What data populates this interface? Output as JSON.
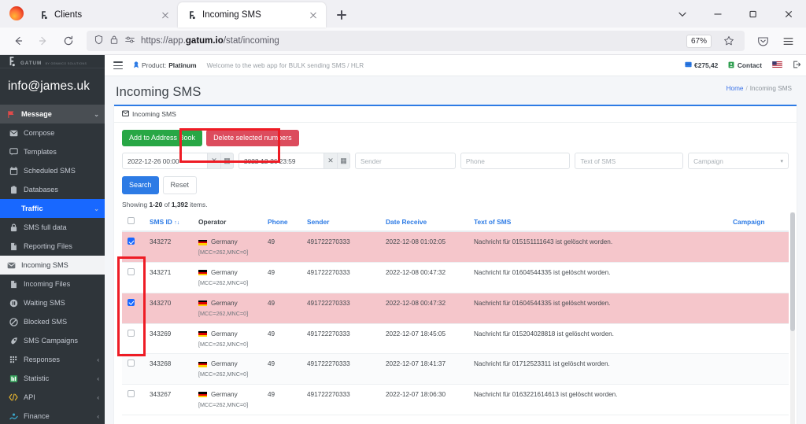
{
  "browser": {
    "tabs": [
      {
        "title": "Clients",
        "favicon": "gatum-favicon",
        "active": false
      },
      {
        "title": "Incoming SMS",
        "favicon": "gatum-favicon",
        "active": true
      }
    ],
    "new_tab_label": "+",
    "url_prefix": "https://app.",
    "url_domain": "gatum.io",
    "url_path": "/stat/incoming",
    "zoom_level": "67%",
    "window_controls": {
      "minimize": "–",
      "maximize": "▢",
      "close": "✕",
      "list_all_tabs": "⌄"
    }
  },
  "sidebar": {
    "brand_name": "GATUM",
    "brand_sub": "BY GENMICO SOLUTIONS",
    "user_email": "info@james.uk",
    "items": [
      {
        "label": "Message",
        "icon": "flag-icon",
        "state": "group-open",
        "caret": "⌄"
      },
      {
        "label": "Compose",
        "icon": "envelope-icon",
        "state": "child",
        "caret": ""
      },
      {
        "label": "Templates",
        "icon": "template-icon",
        "state": "child",
        "caret": ""
      },
      {
        "label": "Scheduled SMS",
        "icon": "calendar-icon",
        "state": "child",
        "caret": ""
      },
      {
        "label": "Databases",
        "icon": "database-icon",
        "state": "child",
        "caret": ""
      },
      {
        "label": "Traffic",
        "icon": "",
        "state": "active-blue",
        "caret": "⌄"
      },
      {
        "label": "SMS full data",
        "icon": "lock-icon",
        "state": "child",
        "caret": ""
      },
      {
        "label": "Reporting Files",
        "icon": "file-icon",
        "state": "child",
        "caret": ""
      },
      {
        "label": "Incoming SMS",
        "icon": "inbox-icon",
        "state": "active-white",
        "caret": ""
      },
      {
        "label": "Incoming Files",
        "icon": "file-icon",
        "state": "child",
        "caret": ""
      },
      {
        "label": "Waiting SMS",
        "icon": "pause-icon",
        "state": "child",
        "caret": ""
      },
      {
        "label": "Blocked SMS",
        "icon": "block-icon",
        "state": "child",
        "caret": ""
      },
      {
        "label": "SMS Campaigns",
        "icon": "rocket-icon",
        "state": "child",
        "caret": ""
      },
      {
        "label": "Responses",
        "icon": "keypad-icon",
        "state": "child",
        "caret": "‹"
      },
      {
        "label": "Statistic",
        "icon": "chart-icon",
        "state": "child",
        "caret": "‹"
      },
      {
        "label": "API",
        "icon": "code-icon",
        "state": "child",
        "caret": "‹"
      },
      {
        "label": "Finance",
        "icon": "finance-icon",
        "state": "child",
        "caret": "‹"
      }
    ]
  },
  "topbar": {
    "menu_toggle": "hamburger-icon",
    "product_label": "Product:",
    "product_value": "Platinum",
    "welcome": "Welcome to the web app for BULK sending SMS / HLR",
    "balance": "€275,42",
    "contact": "Contact",
    "language": "US",
    "logout": "logout-icon"
  },
  "page": {
    "title": "Incoming SMS",
    "breadcrumb_home": "Home",
    "breadcrumb_sep": "/",
    "breadcrumb_current": "Incoming SMS",
    "card_title": "Incoming SMS"
  },
  "toolbar": {
    "add_to_address_book": "Add to Address Book",
    "delete_selected": "Delete selected numbers"
  },
  "filters": {
    "date_from": "2022-12-26 00:00",
    "date_to": "2022-12-26 23:59",
    "clear_icon": "✕",
    "calendar_icon": "▦",
    "sender_placeholder": "Sender",
    "phone_placeholder": "Phone",
    "text_placeholder": "Text of SMS",
    "campaign_placeholder": "Campaign",
    "campaign_caret": "▾",
    "search_button": "Search",
    "reset_button": "Reset"
  },
  "table": {
    "showing_prefix": "Showing",
    "showing_range": "1-20",
    "showing_of": "of",
    "showing_total": "1,392",
    "showing_suffix": "items.",
    "sort_icon": "↑↓",
    "columns": [
      {
        "label": "",
        "key": "checkbox"
      },
      {
        "label": "SMS ID",
        "key": "sms_id",
        "sortable": true
      },
      {
        "label": "Operator",
        "key": "operator",
        "dark": true
      },
      {
        "label": "Phone",
        "key": "phone"
      },
      {
        "label": "Sender",
        "key": "sender"
      },
      {
        "label": "Date Receive",
        "key": "date"
      },
      {
        "label": "Text of SMS",
        "key": "text"
      },
      {
        "label": "Campaign",
        "key": "campaign"
      }
    ],
    "rows": [
      {
        "checked": true,
        "selected": true,
        "sms_id": "343272",
        "country": "Germany",
        "mcc": "[MCC=262,MNC=0]",
        "phone": "49",
        "sender": "491722270333",
        "date": "2022-12-08 01:02:05",
        "text": "Nachricht für 015151111643 ist gelöscht worden.",
        "campaign": ""
      },
      {
        "checked": false,
        "selected": false,
        "sms_id": "343271",
        "country": "Germany",
        "mcc": "[MCC=262,MNC=0]",
        "phone": "49",
        "sender": "491722270333",
        "date": "2022-12-08 00:47:32",
        "text": "Nachricht für 01604544335 ist gelöscht worden.",
        "campaign": ""
      },
      {
        "checked": true,
        "selected": true,
        "sms_id": "343270",
        "country": "Germany",
        "mcc": "[MCC=262,MNC=0]",
        "phone": "49",
        "sender": "491722270333",
        "date": "2022-12-08 00:47:32",
        "text": "Nachricht für 01604544335 ist gelöscht worden.",
        "campaign": ""
      },
      {
        "checked": false,
        "selected": false,
        "sms_id": "343269",
        "country": "Germany",
        "mcc": "[MCC=262,MNC=0]",
        "phone": "49",
        "sender": "491722270333",
        "date": "2022-12-07 18:45:05",
        "text": "Nachricht für 015204028818 ist gelöscht worden.",
        "campaign": ""
      },
      {
        "checked": false,
        "selected": false,
        "alt": true,
        "sms_id": "343268",
        "country": "Germany",
        "mcc": "[MCC=262,MNC=0]",
        "phone": "49",
        "sender": "491722270333",
        "date": "2022-12-07 18:41:37",
        "text": "Nachricht für 01712523311 ist gelöscht worden.",
        "campaign": ""
      },
      {
        "checked": false,
        "selected": false,
        "sms_id": "343267",
        "country": "Germany",
        "mcc": "[MCC=262,MNC=0]",
        "phone": "49",
        "sender": "491722270333",
        "date": "2022-12-07 18:06:30",
        "text": "Nachricht für 0163221614613 ist gelöscht worden.",
        "campaign": ""
      }
    ]
  },
  "annotations": {
    "delete_box": "highlight-delete-selected-numbers",
    "checkbox_box": "highlight-selected-row-checkboxes",
    "color": "#ee1c25"
  }
}
